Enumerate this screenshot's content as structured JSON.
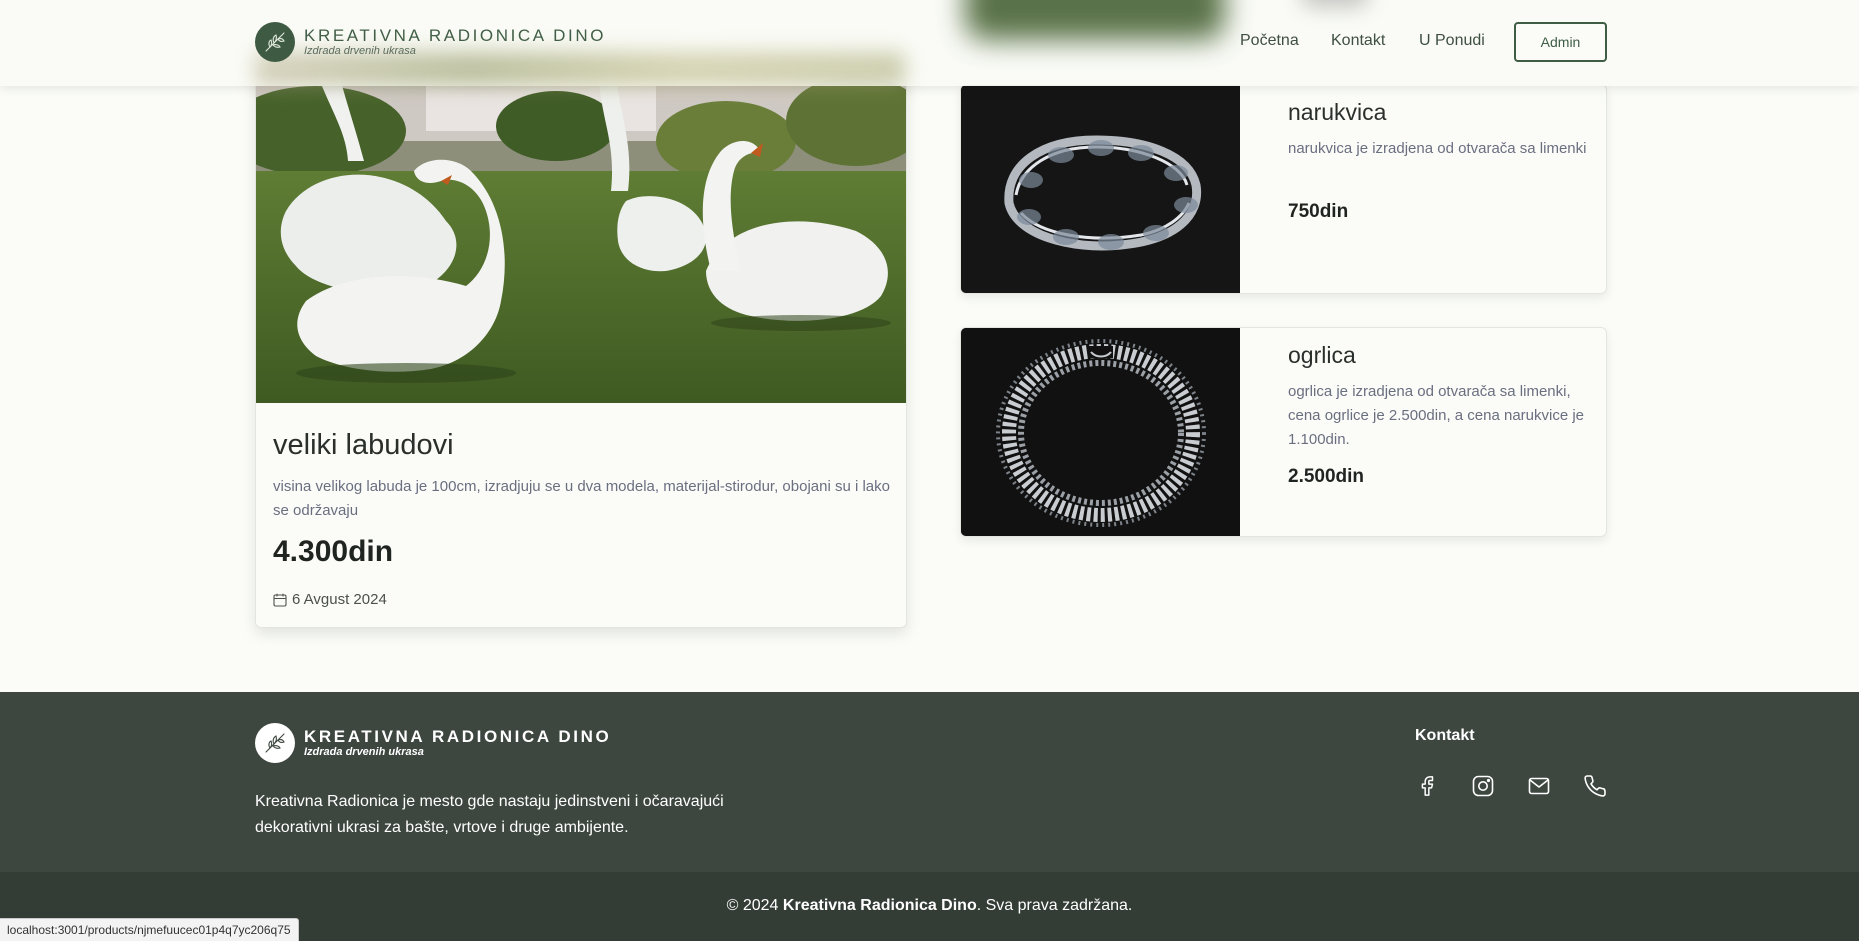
{
  "brand": {
    "title": "KREATIVNA RADIONICA DINO",
    "subtitle": "Izdrada drvenih ukrasa"
  },
  "nav": {
    "items": [
      {
        "label": "Početna"
      },
      {
        "label": "Kontakt"
      },
      {
        "label": "U Ponudi"
      }
    ],
    "admin_label": "Admin"
  },
  "products": {
    "featured": {
      "title": "veliki labudovi",
      "description": "visina velikog labuda je 100cm, izradjuju se u dva modela, materijal-stirodur, obojani su i lako se održavaju",
      "price": "4.300din",
      "date": "6 Avgust 2024"
    },
    "list": [
      {
        "title": "narukvica",
        "description": "narukvica je izradjena od otvarača sa limenki",
        "price": "750din"
      },
      {
        "title": "ogrlica",
        "description": "ogrlica je izradjena od otvarača sa limenki, cena ogrlice je 2.500din, a cena narukvice je 1.100din.",
        "price": "2.500din"
      }
    ]
  },
  "footer": {
    "about": "Kreativna Radionica je mesto gde nastaju jedinstveni i očaravajući dekorativni ukrasi za bašte, vrtove i druge ambijente.",
    "contact_title": "Kontakt",
    "social_icons": [
      "facebook-icon",
      "instagram-icon",
      "mail-icon",
      "phone-icon"
    ],
    "copyright_prefix": "© 2024 ",
    "copyright_brand": "Kreativna Radionica Dino",
    "copyright_suffix": ". Sva prava zadržana."
  },
  "status_bar": {
    "url": "localhost:3001/products/njmefuucec01p4q7yc206q75"
  },
  "colors": {
    "brand_green": "#3f5c45",
    "footer_bg": "#3d463f",
    "copyright_bg": "#343c36",
    "page_bg": "#fbfcf8"
  }
}
